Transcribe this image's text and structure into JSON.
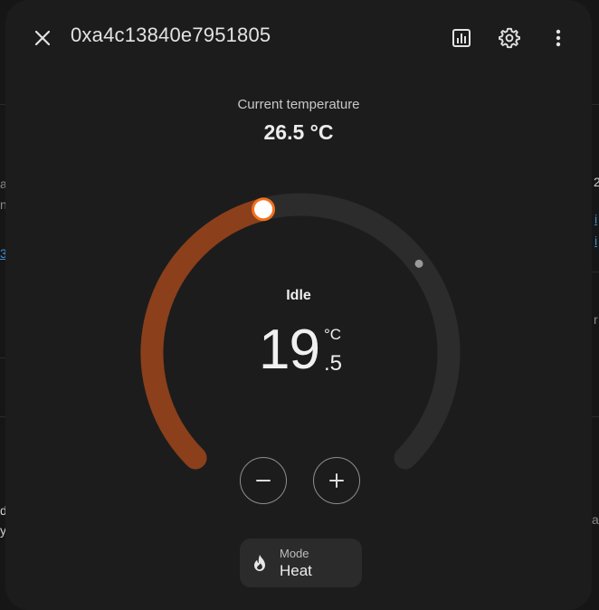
{
  "dialog": {
    "title": "0xa4c13840e7951805",
    "close_icon": "close-icon",
    "history_icon": "chart-box-icon",
    "settings_icon": "gear-icon",
    "more_icon": "dots-vertical-icon"
  },
  "current": {
    "label": "Current temperature",
    "value": "26.5 °C"
  },
  "thermostat": {
    "state": "Idle",
    "target_integer": "19",
    "target_decimal": ".5",
    "unit": "°C",
    "target_value": 19.5,
    "current_value": 26.5,
    "heat_color": "#8b3f1b",
    "handle_color": "#f2711c",
    "track_color": "#2c2c2c"
  },
  "controls": {
    "decrease_icon": "minus-icon",
    "increase_icon": "plus-icon"
  },
  "mode": {
    "label": "Mode",
    "value": "Heat",
    "icon": "fire-icon"
  },
  "background": {
    "fragments_left": [
      "at",
      "n",
      "3",
      "d",
      "y"
    ],
    "fragments_right": [
      "2",
      "i",
      "i",
      "r",
      "ai"
    ]
  }
}
